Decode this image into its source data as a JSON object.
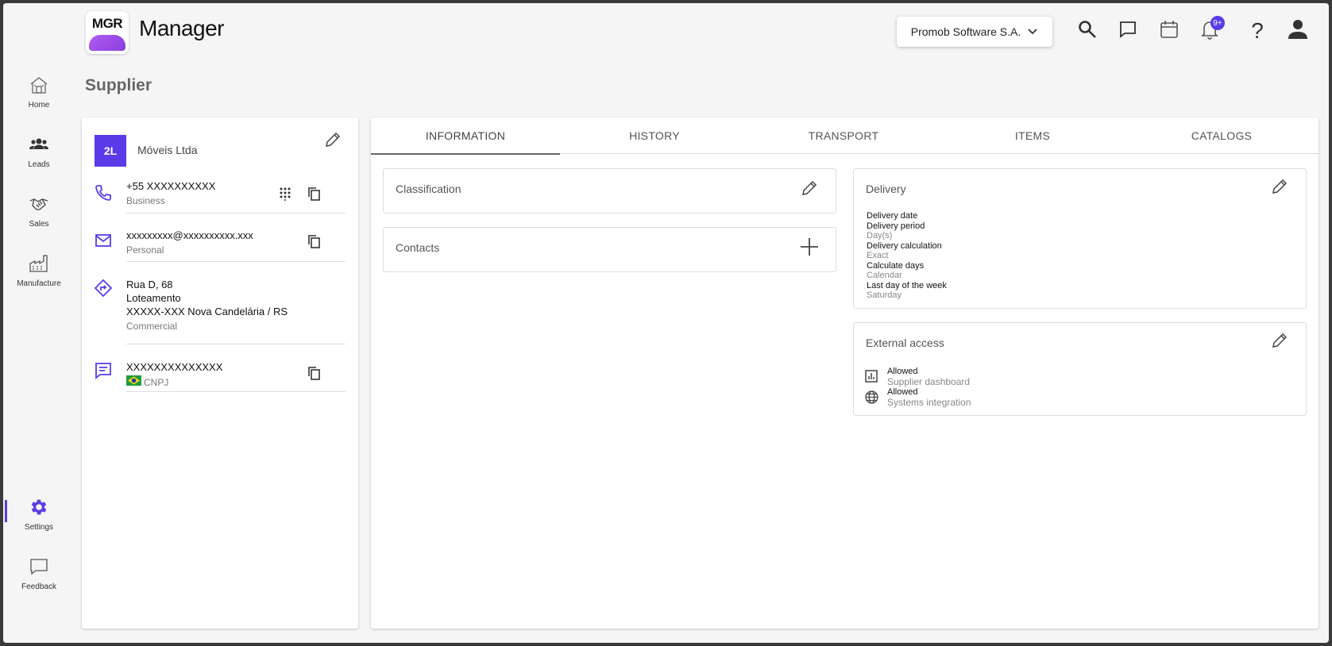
{
  "app": {
    "logo_text": "MGR",
    "title": "Manager",
    "company": "Promob Software S.A.",
    "notifications_badge": "9+",
    "help_label": "?"
  },
  "sidebar": {
    "items": [
      {
        "label": "Home",
        "icon": "home-icon"
      },
      {
        "label": "Leads",
        "icon": "people-icon"
      },
      {
        "label": "Sales",
        "icon": "handshake-icon"
      },
      {
        "label": "Manufacture",
        "icon": "factory-icon"
      },
      {
        "label": "Settings",
        "icon": "gear-icon"
      },
      {
        "label": "Feedback",
        "icon": "feedback-icon"
      }
    ],
    "active": "Settings"
  },
  "page": {
    "title": "Supplier"
  },
  "supplier": {
    "initials": "2L",
    "name": "Móveis Ltda",
    "phone": {
      "value": "+55 XXXXXXXXXX",
      "type": "Business"
    },
    "email": {
      "value": "xxxxxxxxx@xxxxxxxxxx.xxx",
      "type": "Personal"
    },
    "address": {
      "line1": "Rua D, 68",
      "line2": "Loteamento",
      "line3": "XXXXX-XXX Nova Candelária / RS",
      "type": "Commercial"
    },
    "document": {
      "value": "XXXXXXXXXXXXXX",
      "type": "CNPJ"
    }
  },
  "tabs": [
    "INFORMATION",
    "HISTORY",
    "TRANSPORT",
    "ITEMS",
    "CATALOGS"
  ],
  "active_tab": "INFORMATION",
  "panels": {
    "classification": {
      "title": "Classification"
    },
    "contacts": {
      "title": "Contacts"
    },
    "delivery": {
      "title": "Delivery",
      "fields": [
        {
          "label": "Delivery date",
          "value": ""
        },
        {
          "label": "Delivery period",
          "value": "Day(s)"
        },
        {
          "label": "Delivery calculation",
          "value": "Exact"
        },
        {
          "label": "Calculate days",
          "value": "Calendar"
        },
        {
          "label": "Last day of the week",
          "value": "Saturday"
        }
      ]
    },
    "external_access": {
      "title": "External access",
      "items": [
        {
          "status": "Allowed",
          "label": "Supplier dashboard",
          "icon": "chart-icon"
        },
        {
          "status": "Allowed",
          "label": "Systems integration",
          "icon": "globe-icon"
        }
      ]
    }
  },
  "colors": {
    "accent": "#5b3be8"
  }
}
